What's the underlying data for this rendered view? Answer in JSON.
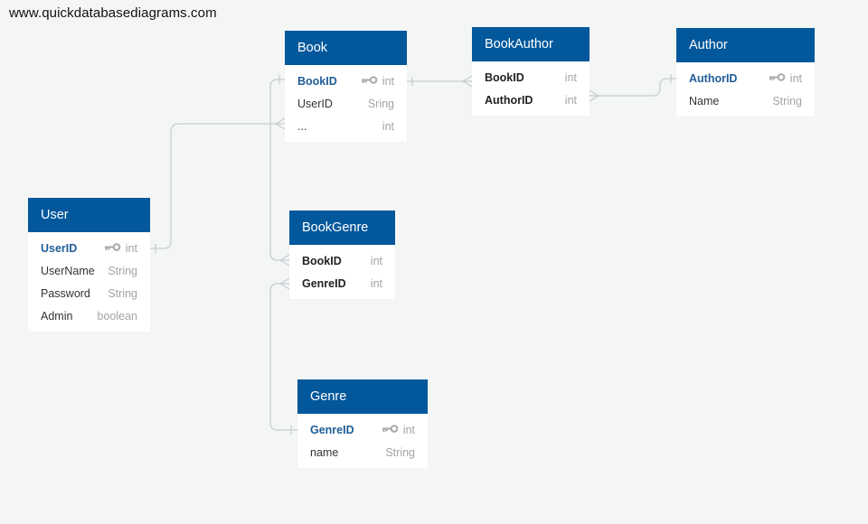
{
  "watermark": "www.quickdatabasediagrams.com",
  "colors": {
    "header": "#03589c",
    "link": "#c8cdd0",
    "pk_text": "#1f5d96"
  },
  "tables": {
    "book": {
      "title": "Book",
      "columns": [
        {
          "name": "BookID",
          "type": "int",
          "pk": true
        },
        {
          "name": "UserID",
          "type": "Sring"
        },
        {
          "name": "...",
          "type": "int"
        }
      ]
    },
    "bookauthor": {
      "title": "BookAuthor",
      "columns": [
        {
          "name": "BookID",
          "type": "int",
          "fk": true
        },
        {
          "name": "AuthorID",
          "type": "int",
          "fk": true
        }
      ]
    },
    "author": {
      "title": "Author",
      "columns": [
        {
          "name": "AuthorID",
          "type": "int",
          "pk": true
        },
        {
          "name": "Name",
          "type": "String"
        }
      ]
    },
    "user": {
      "title": "User",
      "columns": [
        {
          "name": "UserID",
          "type": "int",
          "pk": true
        },
        {
          "name": "UserName",
          "type": "String"
        },
        {
          "name": "Password",
          "type": "String"
        },
        {
          "name": "Admin",
          "type": "boolean"
        }
      ]
    },
    "bookgenre": {
      "title": "BookGenre",
      "columns": [
        {
          "name": "BookID",
          "type": "int",
          "fk": true
        },
        {
          "name": "GenreID",
          "type": "int",
          "fk": true
        }
      ]
    },
    "genre": {
      "title": "Genre",
      "columns": [
        {
          "name": "GenreID",
          "type": "int",
          "pk": true
        },
        {
          "name": "name",
          "type": "String"
        }
      ]
    }
  }
}
